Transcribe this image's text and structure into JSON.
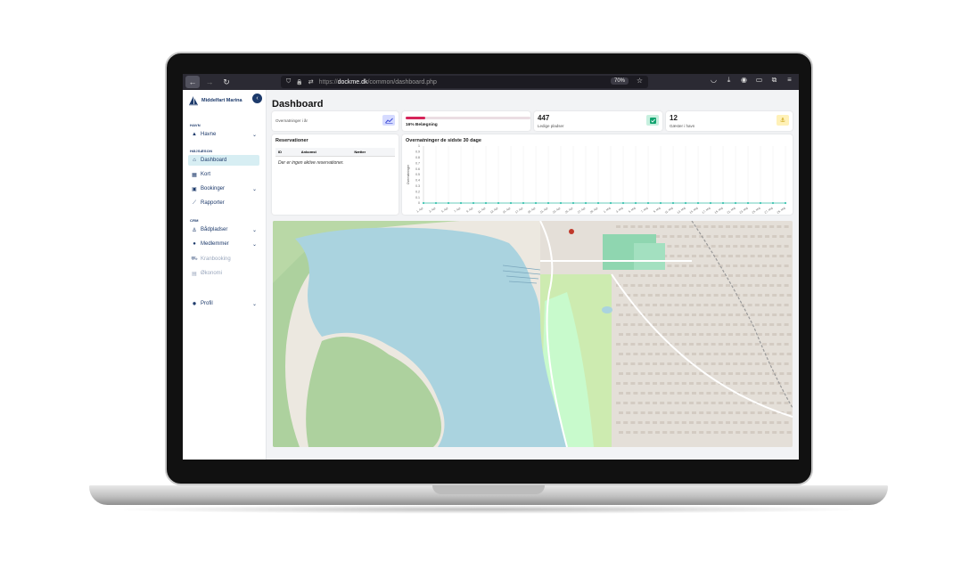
{
  "browser": {
    "url_prefix": "https://",
    "url_domain": "dockme.dk",
    "url_path": "/common/dashboard.php",
    "zoom": "70%"
  },
  "sidebar": {
    "brand": "Middelfart Marina",
    "sections": [
      {
        "label": "HAVN"
      },
      {
        "label": "HØJSÆSON"
      },
      {
        "label": "CRM"
      }
    ],
    "items": [
      {
        "label": "Havne"
      },
      {
        "label": "Dashboard"
      },
      {
        "label": "Kort"
      },
      {
        "label": "Bookinger"
      },
      {
        "label": "Rapporter"
      },
      {
        "label": "Bådpladser"
      },
      {
        "label": "Medlemmer"
      },
      {
        "label": "Kranbooking"
      },
      {
        "label": "Økonomi"
      },
      {
        "label": "Profil"
      }
    ]
  },
  "main": {
    "title": "Dashboard",
    "stats": {
      "overnight": {
        "label": "Overnatninger i år"
      },
      "occupancy": {
        "label": "16% Belægning",
        "percent": 16
      },
      "free": {
        "value": "447",
        "label": "Ledige pladser"
      },
      "guests": {
        "value": "12",
        "label": "Gæster i havn"
      }
    },
    "reservations": {
      "title": "Reservationer",
      "columns": [
        "ID",
        "Ankomst",
        "Nætter"
      ],
      "empty": "Der er ingen aktive reservationer."
    }
  },
  "chart_data": {
    "type": "line",
    "title": "Overnatninger de sidste 30 dage",
    "ylabel": "Overnatninger",
    "xlabel": "",
    "ylim": [
      0,
      1
    ],
    "yticks": [
      "1",
      "0.9",
      "0.8",
      "0.7",
      "0.6",
      "0.5",
      "0.4",
      "0.3",
      "0.2",
      "0.1",
      "0"
    ],
    "categories": [
      "1. Apr",
      "3. Apr",
      "5. Apr",
      "7. Apr",
      "9. Apr",
      "11. Apr",
      "13. Apr",
      "15. Apr",
      "17. Apr",
      "19. Apr",
      "21. Apr",
      "23. Apr",
      "25. Apr",
      "27. Apr",
      "29. Apr",
      "1. Maj",
      "3. Maj",
      "5. Maj",
      "7. Maj",
      "9. Maj",
      "11. Maj",
      "13. Maj",
      "15. Maj",
      "17. Maj",
      "19. Maj",
      "21. Maj",
      "23. Maj",
      "25. Maj",
      "27. Maj",
      "29. Maj"
    ],
    "series": [
      {
        "values": [
          0,
          0,
          0,
          0,
          0,
          0,
          0,
          0,
          0,
          0,
          0,
          0,
          0,
          0,
          0,
          0,
          0,
          0,
          0,
          0,
          0,
          0,
          0,
          0,
          0,
          0,
          0,
          0,
          0,
          0
        ]
      }
    ],
    "color": "#3cc4b0",
    "grid": true
  },
  "colors": {
    "brand": "#1d3a6b",
    "active_bg": "#d7eef3",
    "progress": "#d6245a",
    "water": "#aad3df",
    "forest": "#add19e",
    "park": "#c8facc"
  },
  "icons": {
    "back": "←",
    "forward": "→",
    "reload": "↻",
    "shield": "⛉",
    "lock": "🔒",
    "tune": "⇄",
    "star": "☆",
    "pocket": "◡",
    "download": "⤓",
    "account": "◉",
    "sidebar": "▭",
    "extensions": "⧉",
    "menu": "≡",
    "chevron": "⌄",
    "collapse": "‹",
    "chart": "📈",
    "check": "✔",
    "anchor": "⚓"
  }
}
